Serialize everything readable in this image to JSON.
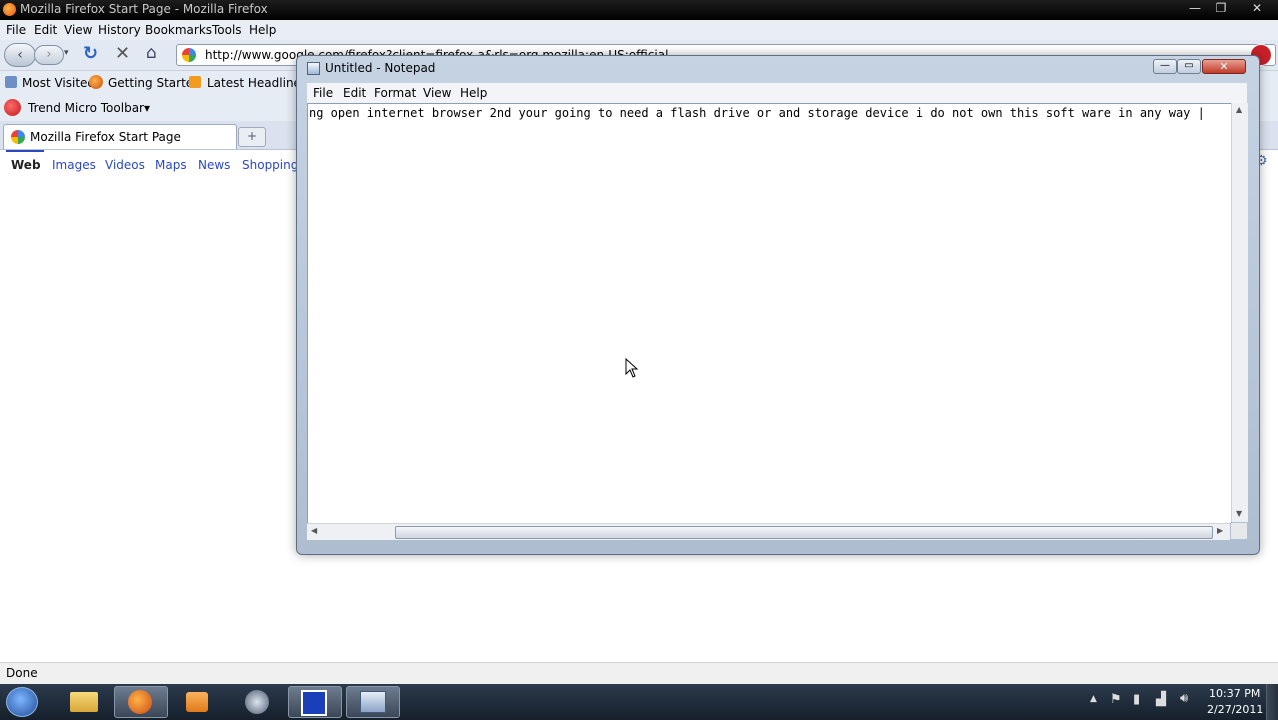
{
  "firefox": {
    "title": "Mozilla Firefox Start Page - Mozilla Firefox",
    "menu": [
      "File",
      "Edit",
      "View",
      "History",
      "Bookmarks",
      "Tools",
      "Help"
    ],
    "url": "http://www.google.com/firefox?client=firefox-a&rls=org.mozilla:en-US:official",
    "bookmarks": [
      "Most Visited",
      "Getting Started",
      "Latest Headlines"
    ],
    "toolbar_name": "Trend Micro Toolbar▾",
    "tab_label": "Mozilla Firefox Start Page",
    "new_tab": "+",
    "google_links": [
      "Web",
      "Images",
      "Videos",
      "Maps",
      "News",
      "Shopping"
    ],
    "status": "Done"
  },
  "notepad": {
    "title": "Untitled - Notepad",
    "menu": [
      "File",
      "Edit",
      "Format",
      "View",
      "Help"
    ],
    "text": "ng open internet browser 2nd your going to need a flash drive or and storage device i do not own this soft ware in any way |"
  },
  "taskbar": {
    "time": "10:37 PM",
    "date": "2/27/2011"
  },
  "colors": {
    "google_link": "#2a49c2",
    "taskbar_bg": "#16202c",
    "firefox_titlebar": "#000000"
  }
}
